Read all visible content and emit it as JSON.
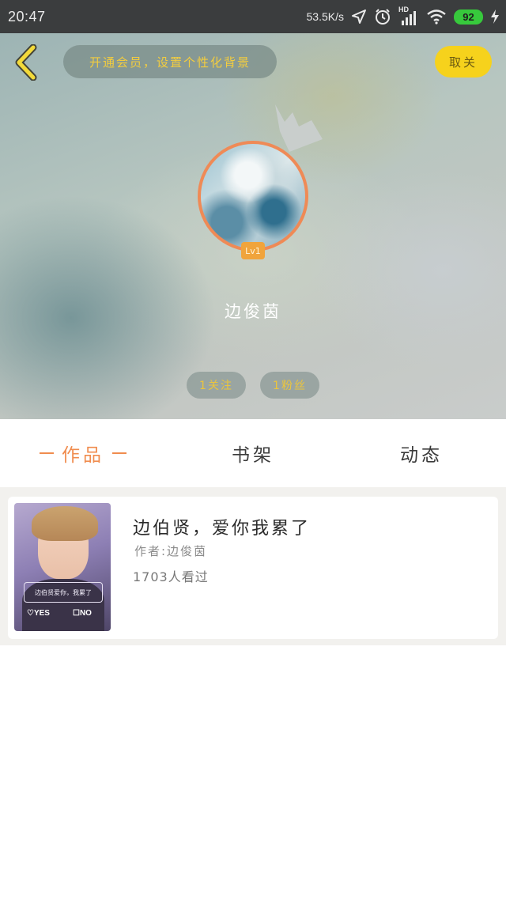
{
  "status_bar": {
    "time": "20:47",
    "net_speed": "53.5K/s",
    "network_type": "HD",
    "battery": "92",
    "icons": [
      "location-arrow-icon",
      "alarm-clock-icon",
      "signal-bars-icon",
      "wifi-icon",
      "battery-icon",
      "charging-bolt-icon"
    ]
  },
  "header": {
    "back_icon": "chevron-left-icon",
    "vip_prompt": "开通会员，设置个性化背景",
    "unfollow_label": "取关",
    "crown_icon": "crown-icon",
    "level": "Lv1",
    "username": "边俊茵",
    "following_label": "1关注",
    "fans_label": "1粉丝"
  },
  "tabs": {
    "works": "作品",
    "shelf": "书架",
    "feed": "动态",
    "active": "works"
  },
  "works": [
    {
      "title": "边伯贤，爱你我累了",
      "author": "作者:边俊茵",
      "views": "1703人看过",
      "cover": {
        "caption": "边伯贤爱你，我累了",
        "yes_label": "♡YES",
        "no_label": "☐NO"
      }
    }
  ],
  "colors": {
    "accent_orange": "#f08c4e",
    "unfollow_yellow": "#f6d21c",
    "pill_text_yellow": "#f3cd3f"
  }
}
